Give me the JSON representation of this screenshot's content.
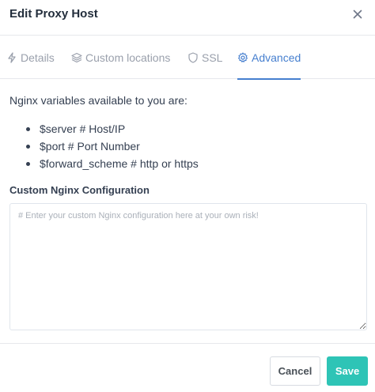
{
  "modal": {
    "title": "Edit Proxy Host",
    "close_icon": "close-icon"
  },
  "tabs": [
    {
      "label": "Details",
      "icon": "bolt-icon",
      "active": false
    },
    {
      "label": "Custom locations",
      "icon": "layers-icon",
      "active": false
    },
    {
      "label": "SSL",
      "icon": "shield-icon",
      "active": false
    },
    {
      "label": "Advanced",
      "icon": "gear-icon",
      "active": true
    }
  ],
  "advanced": {
    "intro": "Nginx variables available to you are:",
    "variables": [
      "$server # Host/IP",
      "$port # Port Number",
      "$forward_scheme # http or https"
    ],
    "config_label": "Custom Nginx Configuration",
    "config_value": "",
    "config_placeholder": "# Enter your custom Nginx configuration here at your own risk!"
  },
  "footer": {
    "cancel_label": "Cancel",
    "save_label": "Save"
  },
  "colors": {
    "accent": "#467fcf",
    "save": "#2ec4b6",
    "muted": "#9aa0ac"
  }
}
